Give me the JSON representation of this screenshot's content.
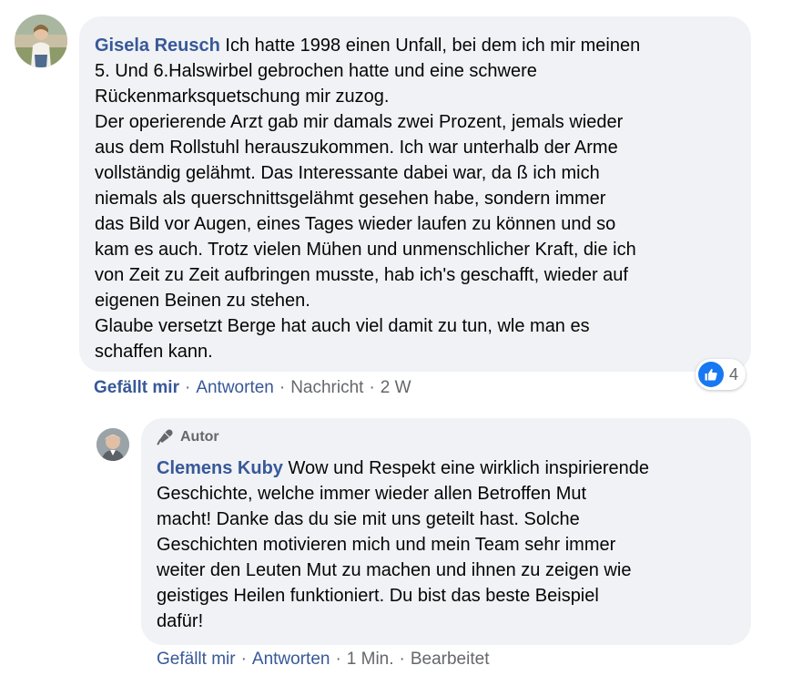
{
  "comment": {
    "author": "Gisela Reusch",
    "text": "Ich hatte 1998 einen Unfall, bei dem ich mir meinen\n5. Und 6.Halswirbel gebrochen hatte und eine schwere\nRückenmarksquetschung mir zuzog.\nDer operierende Arzt gab mir damals zwei Prozent, jemals wieder\naus dem Rollstuhl herauszukommen. Ich war unterhalb der Arme\nvollständig gelähmt. Das Interessante dabei war, da ß ich mich\nniemals als querschnittsgelähmt gesehen habe, sondern immer\ndas Bild vor Augen, eines Tages wieder laufen zu können und so\nkam es auch. Trotz vielen Mühen und unmenschlicher Kraft, die ich\nvon Zeit zu Zeit aufbringen musste, hab ich's geschafft, wieder auf\neigenen Beinen zu stehen.\nGlaube versetzt Berge hat auch viel damit zu tun, wle man es\nschaffen kann.",
    "reaction_count": "4",
    "actions": {
      "like": "Gefällt mir",
      "reply": "Antworten",
      "message": "Nachricht",
      "time": "2 W"
    }
  },
  "reply": {
    "badge": "Autor",
    "author": "Clemens Kuby",
    "text": "Wow und Respekt eine wirklich inspirierende\nGeschichte, welche immer wieder allen Betroffen Mut\nmacht! Danke das du sie mit uns geteilt hast. Solche\nGeschichten motivieren mich und mein Team sehr immer\nweiter den Leuten Mut zu machen und ihnen zu zeigen wie\ngeistiges Heilen funktioniert. Du bist das beste Beispiel\ndafür!",
    "actions": {
      "like": "Gefällt mir",
      "reply": "Antworten",
      "time": "1 Min.",
      "edited": "Bearbeitet"
    }
  },
  "separator": "·",
  "colors": {
    "author_link": "#385898",
    "meta_text": "#65676b",
    "bubble_bg": "#f0f2f5",
    "like_blue": "#1877f2"
  },
  "icons": {
    "reaction": "like-thumb-icon",
    "badge": "microphone-icon"
  }
}
